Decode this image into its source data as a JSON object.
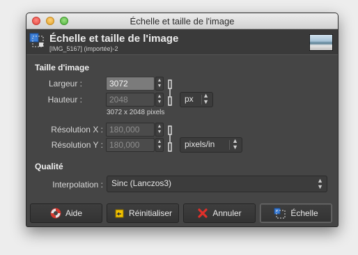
{
  "window": {
    "title": "Échelle et taille de l'image"
  },
  "header": {
    "title": "Échelle et taille de l'image",
    "subtitle": "[IMG_5167] (importée)-2"
  },
  "image_size": {
    "section_title": "Taille d'image",
    "width_label": "Largeur :",
    "width_value": "3072",
    "height_label": "Hauteur :",
    "height_value": "2048",
    "unit": "px",
    "size_info": "3072 x 2048 pixels",
    "res_x_label": "Résolution X :",
    "res_x_value": "180,000",
    "res_y_label": "Résolution Y :",
    "res_y_value": "180,000",
    "res_unit": "pixels/in"
  },
  "quality": {
    "section_title": "Qualité",
    "interpolation_label": "Interpolation :",
    "interpolation_value": "Sinc (Lanczos3)"
  },
  "buttons": {
    "help": "Aide",
    "reset": "Réinitialiser",
    "cancel": "Annuler",
    "scale": "Échelle"
  },
  "colors": {
    "background": "#454545",
    "header": "#3a3a3a",
    "active_field": "#7b7b7b"
  }
}
